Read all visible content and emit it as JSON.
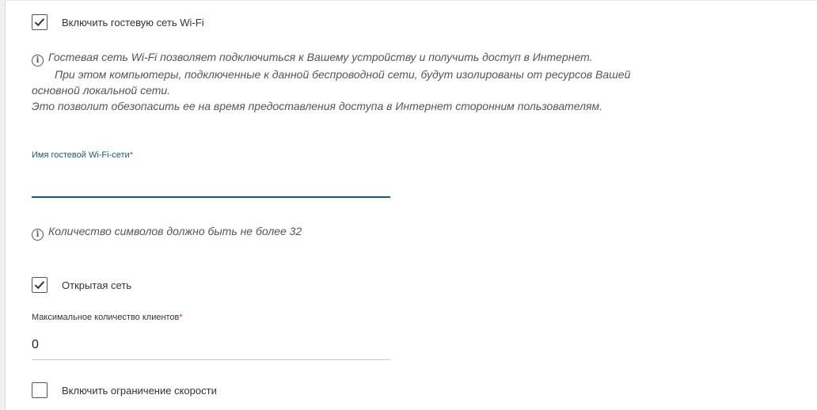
{
  "guest_wifi": {
    "enable_label": "Включить гостевую сеть Wi-Fi",
    "enable_checked": true,
    "info_icon": "info-circle-icon",
    "info_lines": [
      "Гостевая сеть Wi-Fi позволяет подключиться к Вашему устройству и получить доступ в Интернет.",
      "При этом компьютеры, подключенные к данной беспроводной сети, будут изолированы от ресурсов Вашей",
      "основной локальной сети.",
      "Это позволит обезопасить ее на время предоставления доступа в Интернет сторонним пользователям."
    ]
  },
  "ssid_field": {
    "label": "Имя гостевой Wi-Fi-сети",
    "required_mark": "*",
    "value": "",
    "hint": "Количество символов должно быть не более 32"
  },
  "open_network": {
    "label": "Открытая сеть",
    "checked": true
  },
  "max_clients": {
    "label": "Максимальное количество клиентов",
    "required_mark": "*",
    "value": "0"
  },
  "speed_limit": {
    "label": "Включить ограничение скорости",
    "checked": false
  },
  "colors": {
    "accent": "#1a5a7a",
    "required": "#e03030",
    "text": "#333333"
  }
}
